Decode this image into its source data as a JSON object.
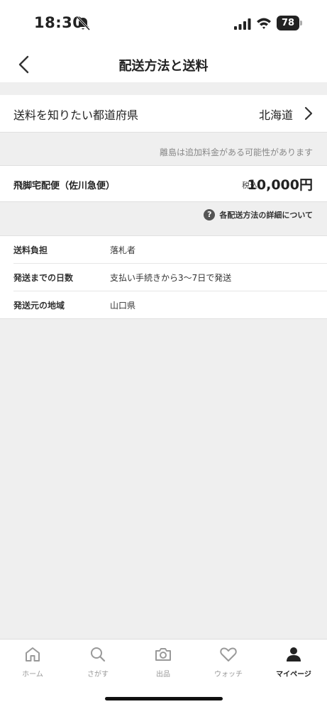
{
  "status_bar": {
    "time": "18:30",
    "battery": "78"
  },
  "header": {
    "title": "配送方法と送料"
  },
  "prefecture": {
    "label": "送料を知りたい都道府県",
    "value": "北海道"
  },
  "notes": {
    "island_note": "離島は追加料金がある可能性があります"
  },
  "shipping_method": {
    "name": "飛脚宅配便（佐川急便）",
    "tax_label": "税込",
    "price": "10,000円"
  },
  "details_link": "各配送方法の詳細について",
  "info": [
    {
      "key": "送料負担",
      "value": "落札者"
    },
    {
      "key": "発送までの日数",
      "value": "支払い手続きから3〜7日で発送"
    },
    {
      "key": "発送元の地域",
      "value": "山口県"
    }
  ],
  "tabs": [
    {
      "label": "ホーム",
      "icon": "home-icon"
    },
    {
      "label": "さがす",
      "icon": "search-icon"
    },
    {
      "label": "出品",
      "icon": "camera-icon"
    },
    {
      "label": "ウォッチ",
      "icon": "heart-icon"
    },
    {
      "label": "マイページ",
      "icon": "person-icon",
      "active": true
    }
  ]
}
